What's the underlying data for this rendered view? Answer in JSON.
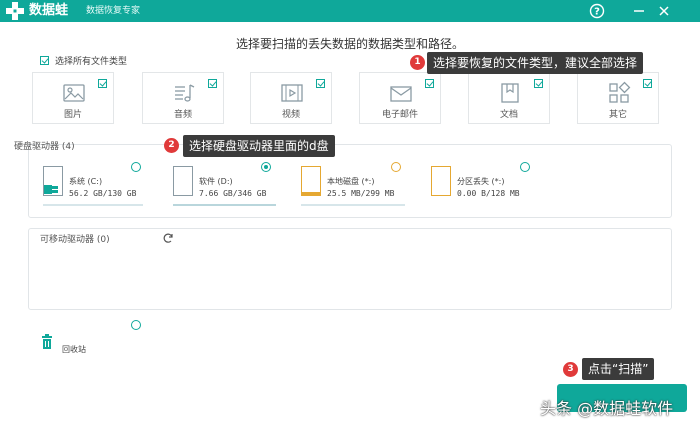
{
  "app": {
    "title": "数据蛙",
    "subtitle": "数据恢复专家"
  },
  "window_controls": {
    "help": "?",
    "minimize": "—",
    "close": "✕"
  },
  "prompt": "选择要扫描的丢失数据的数据类型和路径。",
  "select_all": {
    "label": "选择所有文件类型",
    "checked": true
  },
  "file_types": [
    {
      "label": "图片",
      "icon": "image-icon",
      "checked": true
    },
    {
      "label": "音频",
      "icon": "music-icon",
      "checked": true
    },
    {
      "label": "视频",
      "icon": "video-icon",
      "checked": true
    },
    {
      "label": "电子邮件",
      "icon": "mail-icon",
      "checked": true
    },
    {
      "label": "文档",
      "icon": "document-icon",
      "checked": true
    },
    {
      "label": "其它",
      "icon": "grid-icon",
      "checked": true
    }
  ],
  "hard_drives": {
    "title": "硬盘驱动器 (4)",
    "drives": [
      {
        "name": "系统 (C:)",
        "size": "56.2 GB/130 GB",
        "selected": false
      },
      {
        "name": "软件 (D:)",
        "size": "7.66 GB/346 GB",
        "selected": true
      },
      {
        "name": "本地磁盘 (*:)",
        "size": "25.5 MB/299 MB",
        "selected": false
      },
      {
        "name": "分区丢失 (*:)",
        "size": "0.00  B/128 MB",
        "selected": false
      }
    ]
  },
  "removable": {
    "title": "可移动驱动器 (0)"
  },
  "recycle_bin": {
    "label": "回收站"
  },
  "callouts": [
    {
      "step": "1",
      "text": "选择要恢复的文件类型，建议全部选择"
    },
    {
      "step": "2",
      "text": "选择硬盘驱动器里面的d盘"
    },
    {
      "step": "3",
      "text": "点击“扫描”"
    }
  ],
  "watermark": "头条 @数据蛙软件",
  "colors": {
    "accent": "#0fa89a",
    "callout_bg": "#3b3b3b",
    "step_badge": "#e03a3a"
  }
}
